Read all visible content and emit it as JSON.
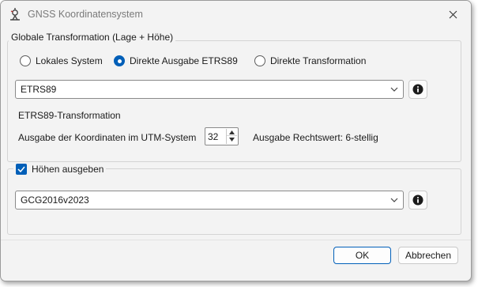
{
  "window": {
    "title": "GNSS Koordinatensystem"
  },
  "icons": {
    "app": "geodesy-tool-icon",
    "close": "close-icon",
    "info": "info-icon",
    "dropdown": "chevron-down-icon"
  },
  "transformation": {
    "legend": "Globale Transformation (Lage + Höhe)",
    "options": [
      {
        "label": "Lokales System",
        "selected": false
      },
      {
        "label": "Direkte Ausgabe ETRS89",
        "selected": true
      },
      {
        "label": "Direkte Transformation",
        "selected": false
      }
    ],
    "system_value": "ETRS89",
    "transformation_label": "ETRS89-Transformation",
    "utm_label": "Ausgabe der Koordinaten im UTM-System",
    "utm_zone": "32",
    "easting_info": "Ausgabe Rechtswert: 6-stellig"
  },
  "height": {
    "checkbox_label": "Höhen ausgeben",
    "checked": true,
    "model_value": "GCG2016v2023"
  },
  "buttons": {
    "ok": "OK",
    "cancel": "Abbrechen"
  },
  "colors": {
    "accent": "#005fb8",
    "background": "#f3f3f3"
  }
}
